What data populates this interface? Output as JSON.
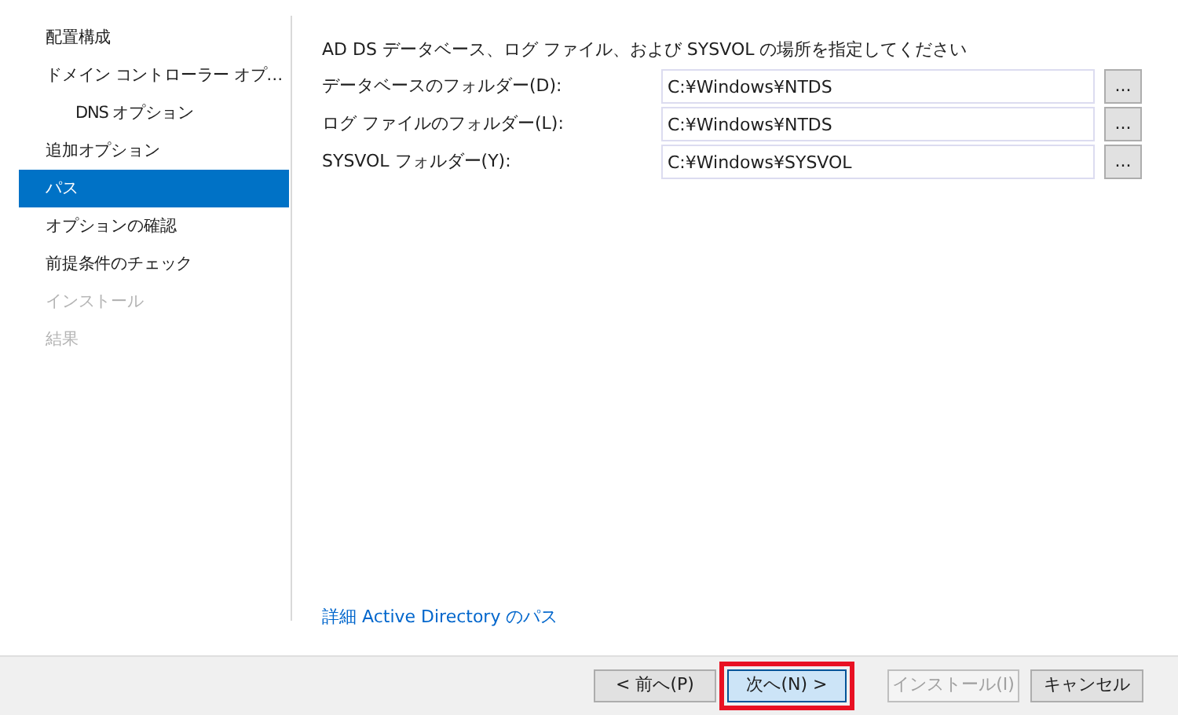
{
  "sidebar": {
    "items": [
      {
        "label": "配置構成",
        "selected": false,
        "disabled": false
      },
      {
        "label": "ドメイン コントローラー オプ…",
        "selected": false,
        "disabled": false,
        "children": [
          {
            "label": "DNS オプション",
            "selected": false,
            "disabled": false
          }
        ]
      },
      {
        "label": "追加オプション",
        "selected": false,
        "disabled": false
      },
      {
        "label": "パス",
        "selected": true,
        "disabled": false
      },
      {
        "label": "オプションの確認",
        "selected": false,
        "disabled": false
      },
      {
        "label": "前提条件のチェック",
        "selected": false,
        "disabled": false
      },
      {
        "label": "インストール",
        "selected": false,
        "disabled": true
      },
      {
        "label": "結果",
        "selected": false,
        "disabled": true
      }
    ]
  },
  "content": {
    "heading": "AD DS データベース、ログ ファイル、および SYSVOL の場所を指定してください",
    "fields": [
      {
        "label": "データベースのフォルダー(D):",
        "value": "C:¥Windows¥NTDS",
        "browse": "..."
      },
      {
        "label": "ログ ファイルのフォルダー(L):",
        "value": "C:¥Windows¥NTDS",
        "browse": "..."
      },
      {
        "label": "SYSVOL フォルダー(Y):",
        "value": "C:¥Windows¥SYSVOL",
        "browse": "..."
      }
    ],
    "link": "詳細 Active Directory のパス"
  },
  "footer": {
    "buttons": [
      {
        "label": "< 前へ(P)",
        "disabled": false,
        "highlighted": false
      },
      {
        "label": "次へ(N) >",
        "disabled": false,
        "highlighted": true
      },
      {
        "label": "インストール(I)",
        "disabled": true,
        "highlighted": false
      },
      {
        "label": "キャンセル",
        "disabled": false,
        "highlighted": false
      }
    ]
  }
}
